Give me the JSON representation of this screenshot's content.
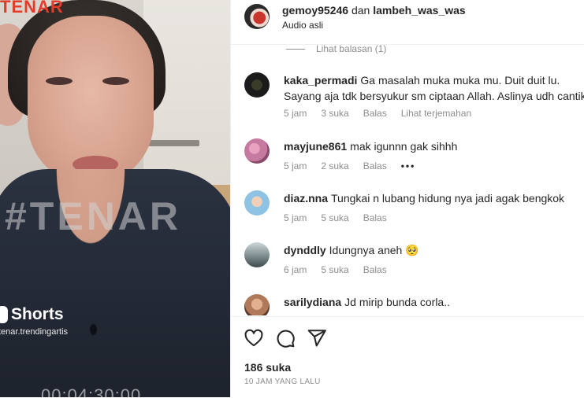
{
  "video": {
    "watermark_top": "TENAR",
    "watermark_mid": "#TENAR",
    "shorts_label": "Shorts",
    "handle_watermark": "tenar.trendingartis",
    "timecode": "00:04:30:00"
  },
  "header": {
    "user1": "gemoy95246",
    "connector": "dan",
    "user2": "lambeh_was_was",
    "audio": "Audio asli"
  },
  "view_replies": "Lihat balasan (1)",
  "comments": [
    {
      "username": "kaka_permadi",
      "text": "Ga masalah muka muka mu. Duit duit lu. Sayang aja tdk bersyukur sm ciptaan Allah. Aslinya udh cantik",
      "time": "5 jam",
      "likes": "3 suka",
      "reply": "Balas",
      "translate": "Lihat terjemahan",
      "avatar_color": "#1b1b1b"
    },
    {
      "username": "mayjune861",
      "text": "mak igunnn gak sihhh",
      "time": "5 jam",
      "likes": "2 suka",
      "reply": "Balas",
      "more": "•••",
      "avatar_color": "#c77aa0"
    },
    {
      "username": "diaz.nna",
      "text": "Tungkai n lubang hidung nya jadi agak bengkok",
      "time": "5 jam",
      "likes": "5 suka",
      "reply": "Balas",
      "avatar_color": "#8fc3e3"
    },
    {
      "username": "dynddly",
      "text": "Idungnya aneh 🥺",
      "time": "6 jam",
      "likes": "5 suka",
      "reply": "Balas",
      "avatar_color": "#5b6b6e"
    },
    {
      "username": "sarilydiana",
      "text": "Jd mirip bunda corla..",
      "avatar_color": "#b07a5a"
    }
  ],
  "actions": {
    "likes": "186 suka",
    "time_ago": "10 JAM YANG LALU"
  }
}
